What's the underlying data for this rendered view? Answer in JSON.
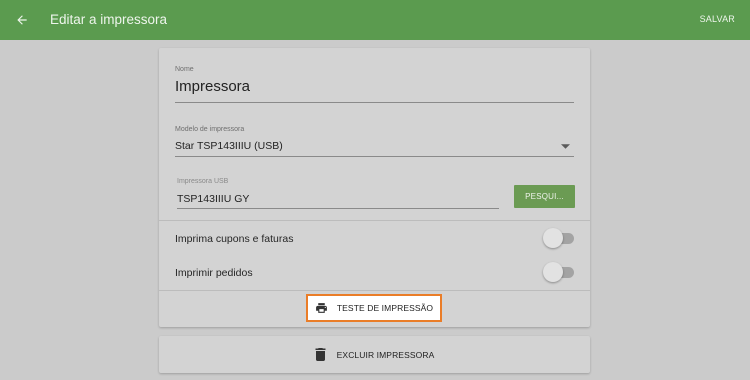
{
  "header": {
    "title": "Editar a impressora",
    "save_label": "SALVAR",
    "back_icon": "arrow-left-icon"
  },
  "form": {
    "name": {
      "label": "Nome",
      "value": "Impressora"
    },
    "model": {
      "label": "Modelo de impressora",
      "value": "Star TSP143IIIU (USB)",
      "icon": "dropdown-arrow-icon"
    },
    "usb": {
      "label": "Impressora USB",
      "value": "TSP143IIIU GY",
      "search_label": "PESQUI..."
    },
    "toggles": [
      {
        "label": "Imprima cupons e faturas",
        "checked": false
      },
      {
        "label": "Imprimir pedidos",
        "checked": false
      }
    ],
    "test_print": {
      "label": "TESTE DE IMPRESSÃO",
      "icon": "printer-icon",
      "highlight_color": "#ea7d28"
    }
  },
  "delete": {
    "label": "EXCLUIR IMPRESSORA",
    "icon": "trash-icon"
  },
  "colors": {
    "appbar": "#5b9b4f",
    "search_button": "#6b9b53",
    "background": "#cbcbcb"
  }
}
